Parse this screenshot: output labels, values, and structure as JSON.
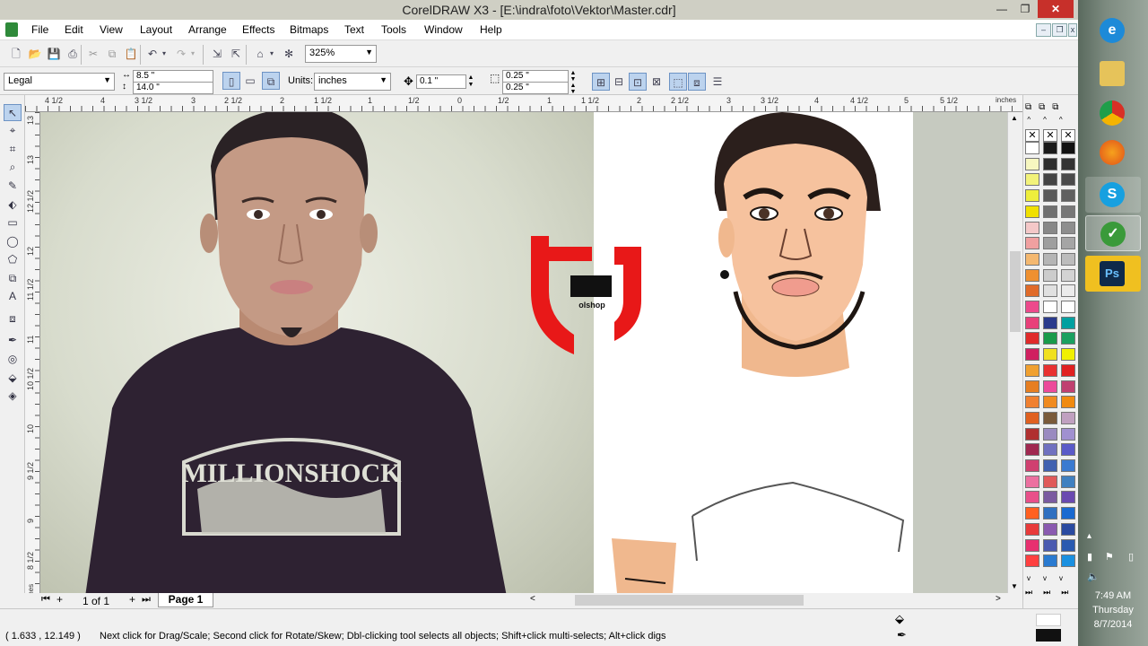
{
  "window": {
    "title": "CorelDRAW X3 - [E:\\indra\\foto\\Vektor\\Master.cdr]",
    "minimize": "—",
    "restore": "❐",
    "close": "✕"
  },
  "menu": {
    "items": [
      "File",
      "Edit",
      "View",
      "Layout",
      "Arrange",
      "Effects",
      "Bitmaps",
      "Text",
      "Tools",
      "Window",
      "Help"
    ]
  },
  "toolbar": {
    "zoom": "325%"
  },
  "property_bar": {
    "paper_size": "Legal",
    "width": "8.5 \"",
    "height": "14.0 \"",
    "units_label": "Units:",
    "units": "inches",
    "nudge": "0.1 \"",
    "dup_x": "0.25 \"",
    "dup_y": "0.25 \""
  },
  "rulers": {
    "h_labels": [
      "4 1/2",
      "4",
      "3 1/2",
      "3",
      "2 1/2",
      "2",
      "1 1/2",
      "1",
      "1/2",
      "0",
      "1/2",
      "1",
      "1 1/2",
      "2",
      "2 1/2",
      "3",
      "3 1/2",
      "4",
      "4 1/2",
      "5",
      "5 1/2",
      "inches"
    ],
    "v_labels": [
      "13",
      "13",
      "12 1/2",
      "12",
      "11 1/2",
      "11",
      "10 1/2",
      "10",
      "9 1/2",
      "9",
      "8 1/2",
      "inches"
    ]
  },
  "artwork": {
    "shirt_text": "MILLIONSHOCK",
    "logo_text": "olshop"
  },
  "pager": {
    "page_count": "1 of 1",
    "tab": "Page 1"
  },
  "status": {
    "coords": "( 1.633 , 12.149 )",
    "hint": "Next click for Drag/Scale; Second click for Rotate/Skew; Dbl-clicking tool selects all objects; Shift+click multi-selects; Alt+click digs"
  },
  "clock": {
    "time": "7:49 AM",
    "day": "Thursday",
    "date": "8/7/2014"
  },
  "taskbar_icons": [
    "internet-explorer-icon",
    "file-explorer-icon",
    "chrome-icon",
    "firefox-icon",
    "skype-icon",
    "coreldraw-icon",
    "photoshop-icon"
  ],
  "palette_colors": {
    "col1": [
      "#ffffff",
      "#f7f7c0",
      "#f2f27a",
      "#eeee3c",
      "#f0e000",
      "#f4c8c8",
      "#f0a0a0",
      "#f4b870",
      "#ee9030",
      "#e06b2a",
      "#ec4a8c",
      "#e8407a",
      "#e02a2a",
      "#d02060",
      "#f0a030",
      "#e67e22",
      "#f08030",
      "#e06020",
      "#b03030",
      "#a02850",
      "#d04070",
      "#ec70a0",
      "#e8508a",
      "#ff6020",
      "#e83a3a",
      "#e83070",
      "#ff4040"
    ],
    "col2": [
      "#1a1a1a",
      "#2e2e2e",
      "#444444",
      "#5a5a5a",
      "#707070",
      "#888888",
      "#9e9e9e",
      "#b5b5b5",
      "#cccccc",
      "#e0e0e0",
      "#ffffff",
      "#2a3a8c",
      "#1a9a4a",
      "#f0e020",
      "#e83030",
      "#ec4a9a",
      "#f08a20",
      "#7a5a3a",
      "#9a8ac0",
      "#7070c0",
      "#4060b0",
      "#e05a5a",
      "#7a5aa0",
      "#3070c0",
      "#8a5ab0",
      "#4a5ab0",
      "#2a7ad0"
    ],
    "col3": [
      "#111111",
      "#333333",
      "#4a4a4a",
      "#606060",
      "#777777",
      "#8e8e8e",
      "#a5a5a5",
      "#bcbcbc",
      "#d3d3d3",
      "#ebebeb",
      "#ffffff",
      "#00a0a0",
      "#1aa060",
      "#f0f000",
      "#e02020",
      "#c04070",
      "#f08a10",
      "#c0a0c0",
      "#a090d0",
      "#5a5ac8",
      "#3a7ad0",
      "#4080c0",
      "#6a4ab0",
      "#1a6ad0",
      "#2a4aa0",
      "#2a5ab0",
      "#1a90e0"
    ]
  }
}
